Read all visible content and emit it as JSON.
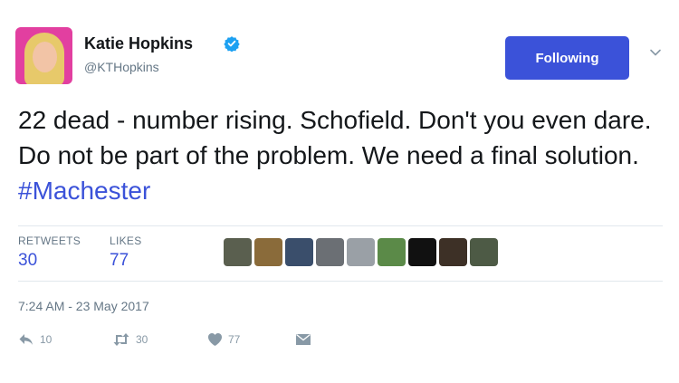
{
  "author": {
    "name": "Katie Hopkins",
    "handle": "@KTHopkins",
    "verified": true
  },
  "follow_button": {
    "label": "Following"
  },
  "tweet": {
    "text_prefix": "22 dead - number rising. Schofield. Don't you even dare. Do not be part of the problem. We need a final solution.",
    "hashtag": "#Machester"
  },
  "stats": {
    "retweets_label": "RETWEETS",
    "retweets": "30",
    "likes_label": "LIKES",
    "likes": "77"
  },
  "timestamp": "7:24 AM - 23 May 2017",
  "actions": {
    "reply_count": "10",
    "retweet_count": "30",
    "like_count": "77"
  },
  "icons": {
    "verified": "verified-badge-icon",
    "chevron": "chevron-down-icon",
    "reply": "reply-icon",
    "retweet": "retweet-icon",
    "like": "heart-icon",
    "message": "direct-message-icon"
  },
  "colors": {
    "accent": "#3b52d9",
    "text": "#14171a",
    "muted": "#657786",
    "action_gray": "#8899a6",
    "avatar_bg": "#e23fa0"
  }
}
